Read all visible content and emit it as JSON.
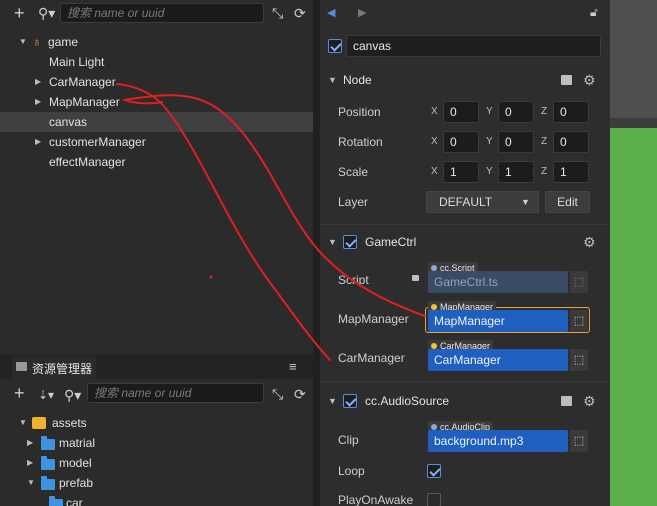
{
  "hierarchy": {
    "search_placeholder": "搜索 name or uuid",
    "items": [
      {
        "label": "game",
        "expanded": true,
        "root": true
      },
      {
        "label": "Main Light"
      },
      {
        "label": "CarManager",
        "collapsed": true
      },
      {
        "label": "MapManager",
        "collapsed": true
      },
      {
        "label": "canvas",
        "selected": true
      },
      {
        "label": "customerManager",
        "collapsed": true
      },
      {
        "label": "effectManager"
      }
    ]
  },
  "assets_panel": {
    "title": "资源管理器",
    "search_placeholder": "搜索 name or uuid",
    "items": [
      {
        "label": "assets"
      },
      {
        "label": "matrial"
      },
      {
        "label": "model"
      },
      {
        "label": "prefab"
      },
      {
        "label": "car"
      }
    ]
  },
  "inspector": {
    "node_name": "canvas",
    "node_section": {
      "title": "Node",
      "position": {
        "label": "Position",
        "x": "0",
        "y": "0",
        "z": "0"
      },
      "rotation": {
        "label": "Rotation",
        "x": "0",
        "y": "0",
        "z": "0"
      },
      "scale": {
        "label": "Scale",
        "x": "1",
        "y": "1",
        "z": "1"
      },
      "layer": {
        "label": "Layer",
        "value": "DEFAULT",
        "edit_label": "Edit"
      },
      "axis_x": "X",
      "axis_y": "Y",
      "axis_z": "Z"
    },
    "gamectrl": {
      "title": "GameCtrl",
      "script_label": "Script",
      "script_type": "cc.Script",
      "script_value": "GameCtrl.ts",
      "map_label": "MapManager",
      "map_type": "MapManager",
      "map_value": "MapManager",
      "car_label": "CarManager",
      "car_type": "CarManager",
      "car_value": "CarManager"
    },
    "audio": {
      "title": "cc.AudioSource",
      "clip_label": "Clip",
      "clip_type": "cc.AudioClip",
      "clip_value": "background.mp3",
      "loop_label": "Loop",
      "loop_checked": true,
      "play_label": "PlayOnAwake",
      "play_checked": false
    }
  },
  "colors": {
    "accent_blue": "#1e5fc0",
    "selection_border": "#e8a43c",
    "scribble_red": "#e02020"
  }
}
